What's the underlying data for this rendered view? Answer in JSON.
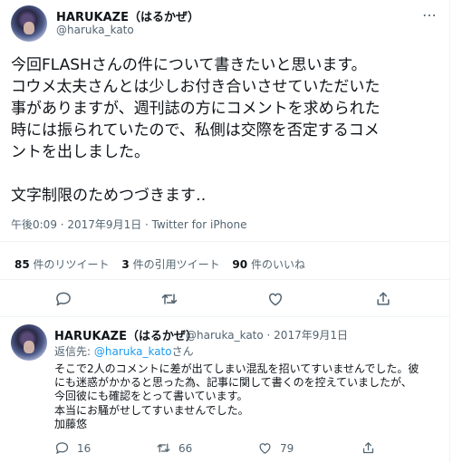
{
  "tweet": {
    "name": "HARUKAZE（はるかぜ）",
    "handle": "@haruka_kato",
    "body": "今回FLASHさんの件について書きたいと思います。\nコウメ太夫さんとは少しお付き合いさせていただいた\n事がありますが、週刊誌の方にコメントを求められた\n時には振られていたので、私側は交際を否定するコメ\nントを出しました。\n\n文字制限のためつづきます‥",
    "meta": "午後0:09 · 2017年9月1日 · Twitter for iPhone",
    "retweets_count": "85",
    "retweets_label": "件のリツイート",
    "quotes_count": "3",
    "quotes_label": "件の引用ツイート",
    "likes_count": "90",
    "likes_label": "件のいいね"
  },
  "reply": {
    "name": "HARUKAZE（はるかぜ）",
    "handle_date": "@haruka_kato · 2017年9月1日",
    "reply_to_prefix": "返信先: ",
    "reply_to_user": "@haruka_kato",
    "reply_to_suffix": "さん",
    "body": "そこで2人のコメントに差が出てしまい混乱を招いてすいませんでした。彼\nにも迷惑がかかると思った為、記事に関して書くのを控えていましたが、\n今回彼にも確認をとって書いています。\n本当にお騒がせしてすいませんでした。\n加藤悠",
    "reply_count": "16",
    "retweet_count": "66",
    "like_count": "79"
  },
  "icons": [
    "more-icon",
    "reply-icon",
    "retweet-icon",
    "like-icon",
    "share-icon"
  ],
  "colors": {
    "accent": "#1d9bf0",
    "secondary_text": "#536471",
    "divider": "#eff3f4"
  }
}
